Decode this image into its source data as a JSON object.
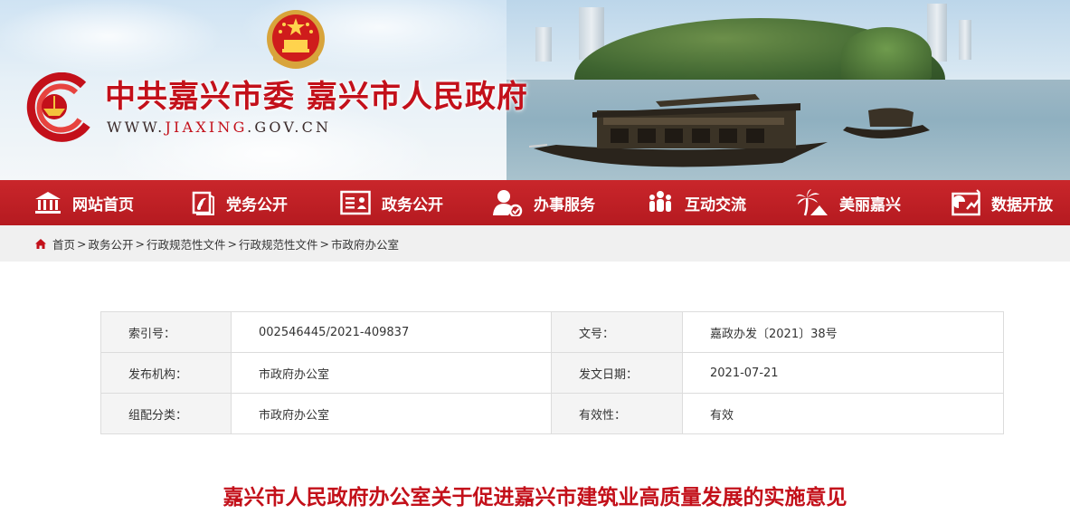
{
  "header": {
    "site_title": "中共嘉兴市委 嘉兴市人民政府",
    "url_prefix": "WWW.",
    "url_domain": "JIAXING",
    "url_suffix": ".GOV.CN"
  },
  "nav": {
    "items": [
      {
        "label": "网站首页",
        "icon": "home-icon"
      },
      {
        "label": "党务公开",
        "icon": "party-icon"
      },
      {
        "label": "政务公开",
        "icon": "document-icon"
      },
      {
        "label": "办事服务",
        "icon": "service-icon"
      },
      {
        "label": "互动交流",
        "icon": "people-icon"
      },
      {
        "label": "美丽嘉兴",
        "icon": "palm-icon"
      },
      {
        "label": "数据开放",
        "icon": "chart-icon"
      }
    ]
  },
  "breadcrumb": {
    "items": [
      "首页",
      "政务公开",
      "行政规范性文件",
      "行政规范性文件",
      "市政府办公室"
    ],
    "separator": ">"
  },
  "meta": {
    "rows": [
      {
        "label1": "索引号：",
        "value1": "002546445/2021-409837",
        "label2": "文号：",
        "value2": "嘉政办发〔2021〕38号"
      },
      {
        "label1": "发布机构：",
        "value1": "市政府办公室",
        "label2": "发文日期：",
        "value2": "2021-07-21"
      },
      {
        "label1": "组配分类：",
        "value1": "市政府办公室",
        "label2": "有效性：",
        "value2": "有效"
      }
    ]
  },
  "article": {
    "title": "嘉兴市人民政府办公室关于促进嘉兴市建筑业高质量发展的实施意见"
  },
  "colors": {
    "brand_red": "#c3101a",
    "nav_red": "#be1f25",
    "crumb_bg": "#f0f0f0"
  }
}
